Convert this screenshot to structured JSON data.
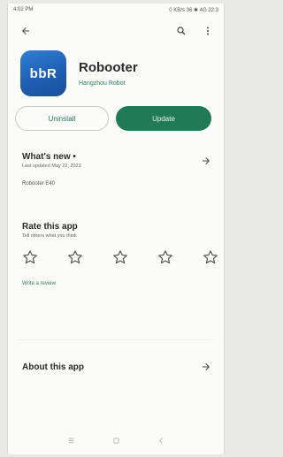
{
  "status_bar": {
    "time": "4:02 PM",
    "indicators": "0 KB/s 36 ✱ 4G 22:3"
  },
  "toolbar": {
    "back_icon": "arrow-left-icon",
    "search_icon": "search-icon",
    "menu_icon": "more-vert-icon"
  },
  "app": {
    "icon_text": "bbR",
    "name": "Robooter",
    "developer": "Hangzhou Robot",
    "colors": {
      "icon_bg": "#1f5fb3",
      "accent": "#1f7a55"
    }
  },
  "actions": {
    "uninstall_label": "Uninstall",
    "update_label": "Update"
  },
  "whats_new": {
    "title": "What's new •",
    "last_updated": "Last updated May 22, 2023",
    "body": "Robooter E40"
  },
  "rate": {
    "title": "Rate this app",
    "subtitle": "Tell others what you think",
    "stars": 5,
    "write_review": "Write a review"
  },
  "about": {
    "title": "About this app"
  }
}
